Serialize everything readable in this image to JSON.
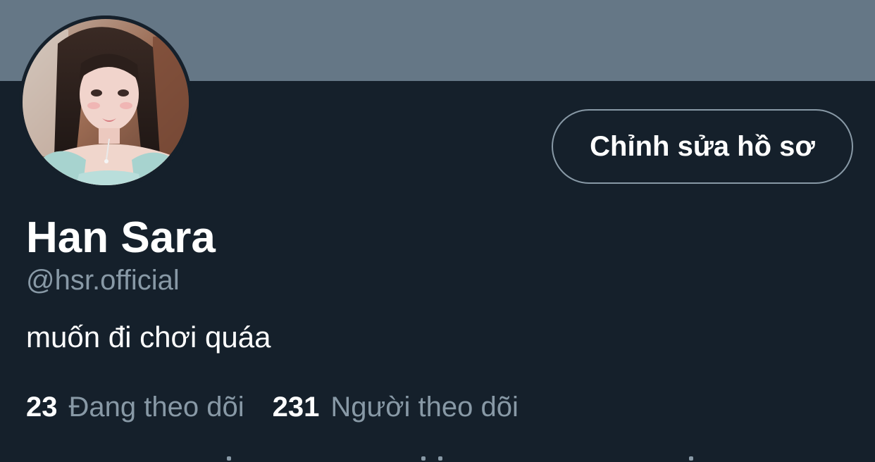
{
  "profile": {
    "display_name": "Han Sara",
    "handle": "@hsr.official",
    "bio": "muốn đi chơi quáa",
    "edit_button_label": "Chỉnh sửa hồ sơ",
    "avatar_icon": "profile-photo",
    "stats": {
      "following_count": "23",
      "following_label": "Đang theo dõi",
      "followers_count": "231",
      "followers_label": "Người theo dõi"
    }
  },
  "colors": {
    "background": "#15202b",
    "banner": "#657786",
    "text_primary": "#ffffff",
    "text_secondary": "#8899a6",
    "button_border": "#8899a6"
  }
}
